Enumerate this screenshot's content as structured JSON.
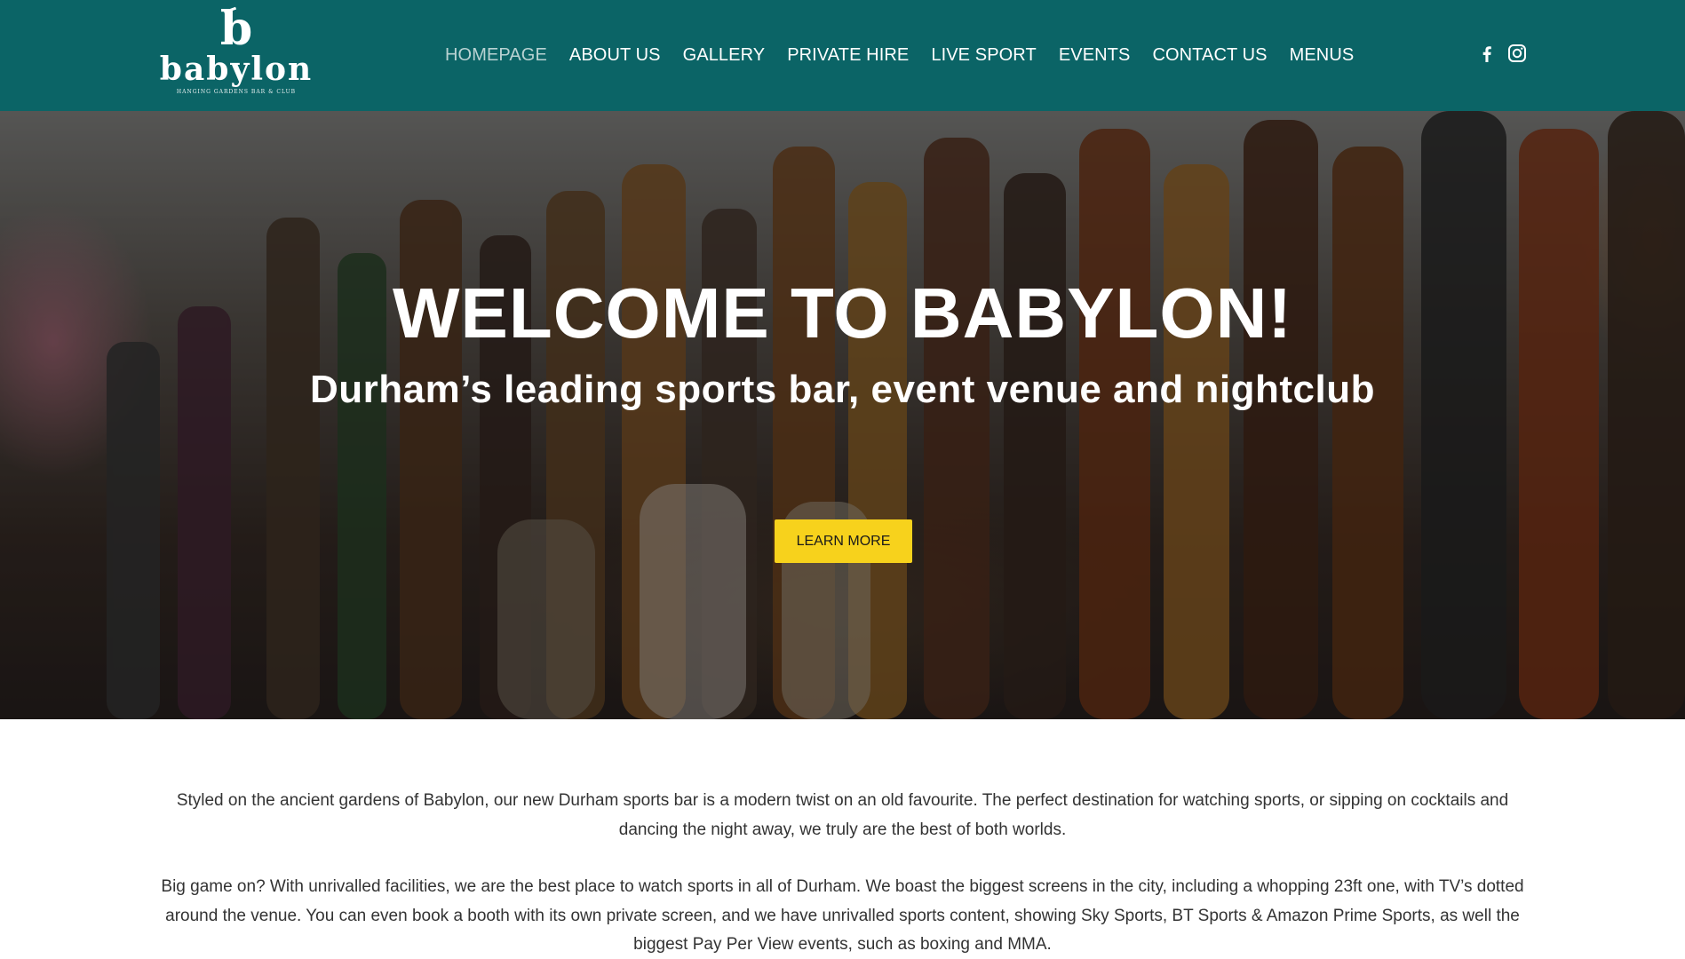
{
  "logo": {
    "mark": "b",
    "wordmark": "babylon",
    "tagline": "HANGING GARDENS BAR & CLUB"
  },
  "nav": {
    "items": [
      {
        "label": "HOMEPAGE",
        "active": true
      },
      {
        "label": "ABOUT US",
        "active": false
      },
      {
        "label": "GALLERY",
        "active": false
      },
      {
        "label": "PRIVATE HIRE",
        "active": false
      },
      {
        "label": "LIVE SPORT",
        "active": false
      },
      {
        "label": "EVENTS",
        "active": false
      },
      {
        "label": "CONTACT US",
        "active": false
      },
      {
        "label": "MENUS",
        "active": false
      }
    ]
  },
  "social": {
    "icons": [
      "facebook-icon",
      "instagram-icon"
    ]
  },
  "hero": {
    "title": "WELCOME TO BABYLON!",
    "subtitle": "Durham’s leading sports bar, event venue and nightclub",
    "button_label": "LEARN MORE"
  },
  "intro": {
    "paragraphs": [
      "Styled on the ancient gardens of Babylon, our new Durham sports bar is a modern twist on an old favourite. The perfect destination for watching sports, or sipping on cocktails and dancing the night away, we truly are the best of both worlds.",
      "Big game on? With unrivalled facilities, we are the best place to watch sports in all of Durham. We boast the biggest screens in the city, including a whopping 23ft one, with TV’s dotted around the venue. You can even book a booth with its own private screen, and we have unrivalled sports content, showing Sky Sports, BT Sports & Amazon Prime Sports, as well the biggest Pay Per View events, such as boxing and MMA."
    ]
  },
  "colors": {
    "header_bg": "#0b6466",
    "nav_active": "#b8d2d2",
    "button_bg": "#f7d21c",
    "body_text": "#333333"
  }
}
